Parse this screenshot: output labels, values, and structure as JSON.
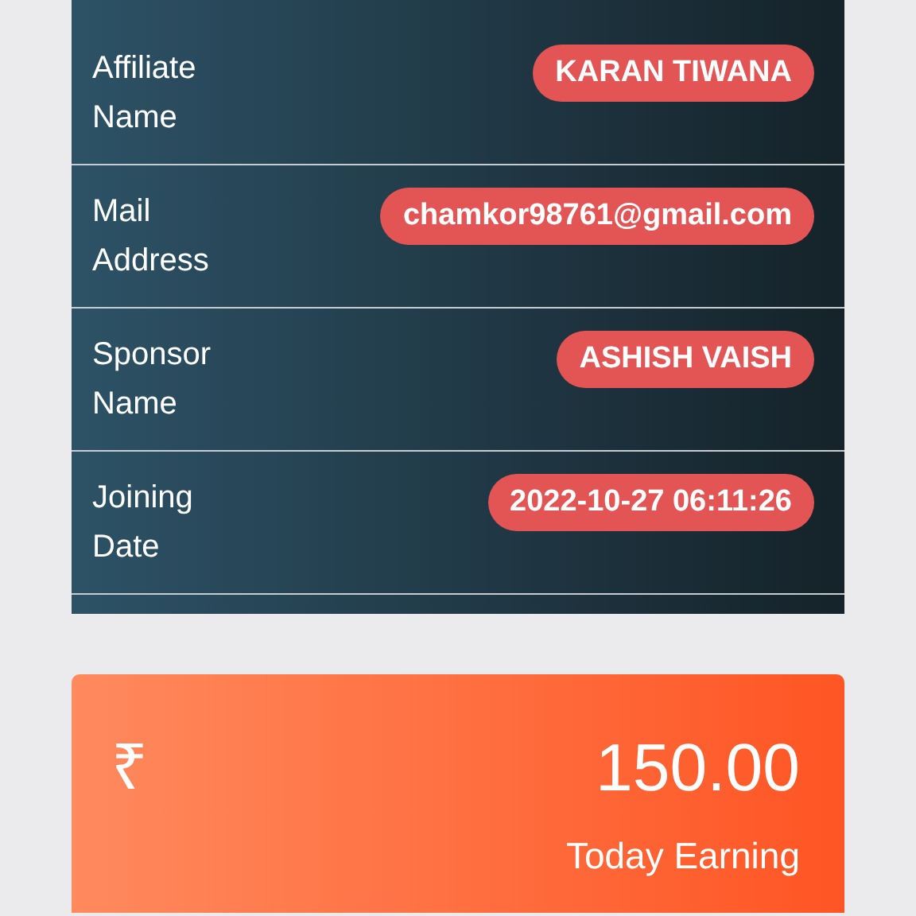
{
  "profile_rows": [
    {
      "label": "Affiliate Name",
      "value": "KARAN TIWANA"
    },
    {
      "label": "Mail Address",
      "value": "chamkor98761@gmail.com"
    },
    {
      "label": "Sponsor Name",
      "value": "ASHISH VAISH"
    },
    {
      "label": "Joining Date",
      "value": "2022-10-27 06:11:26"
    }
  ],
  "earning_card": {
    "currency": "₹",
    "amount": "150.00",
    "caption": "Today Earning"
  }
}
